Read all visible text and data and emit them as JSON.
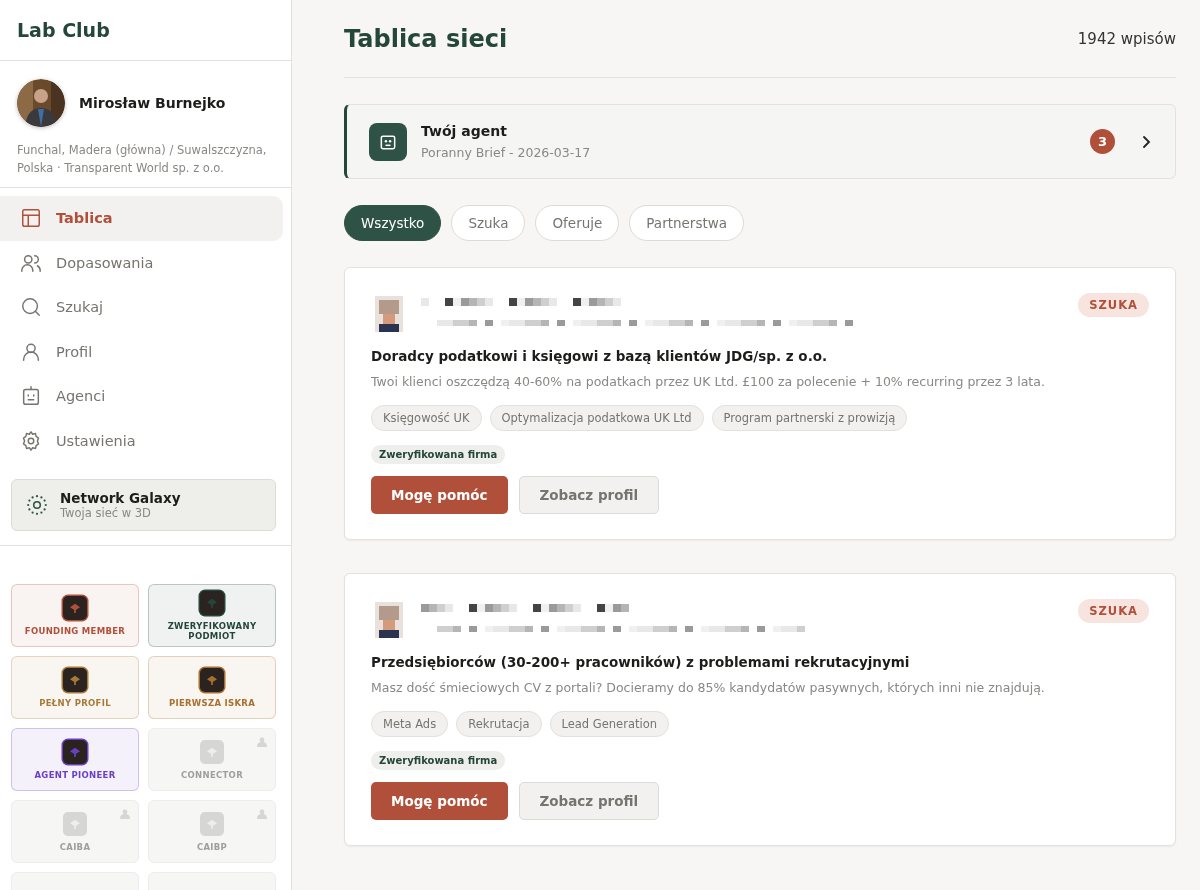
{
  "brand": "Lab Club",
  "profile": {
    "name": "Mirosław Burnejko",
    "details": "Funchal, Madera (główna) / Suwalszczyzna, Polska · Transparent World sp. z o.o."
  },
  "nav": [
    {
      "label": "Tablica",
      "selected": true
    },
    {
      "label": "Dopasowania",
      "selected": false
    },
    {
      "label": "Szukaj",
      "selected": false
    },
    {
      "label": "Profil",
      "selected": false
    },
    {
      "label": "Agenci",
      "selected": false
    },
    {
      "label": "Ustawienia",
      "selected": false
    }
  ],
  "galaxy": {
    "title": "Network Galaxy",
    "subtitle": "Twoja sieć w 3D"
  },
  "badges": [
    {
      "label": "FOUNDING MEMBER",
      "locked": false,
      "color": "#b0503a"
    },
    {
      "label": "ZWERYFIKOWANY PODMIOT",
      "locked": false,
      "color": "#24463b"
    },
    {
      "label": "PEŁNY PROFIL",
      "locked": false,
      "color": "#a77a3a"
    },
    {
      "label": "PIERWSZA ISKRA",
      "locked": false,
      "color": "#a96f2f"
    },
    {
      "label": "AGENT PIONEER",
      "locked": false,
      "color": "#6a3fc4"
    },
    {
      "label": "CONNECTOR",
      "locked": true
    },
    {
      "label": "CAIBA",
      "locked": true
    },
    {
      "label": "CAIBP",
      "locked": true
    },
    {
      "locked": true
    },
    {
      "locked": true
    }
  ],
  "header": {
    "title": "Tablica sieci",
    "count": "1942 wpisów"
  },
  "agent": {
    "title": "Twój agent",
    "subtitle": "Poranny Brief - 2026-03-17",
    "count": "3"
  },
  "filters": [
    {
      "label": "Wszystko",
      "selected": true
    },
    {
      "label": "Szuka",
      "selected": false
    },
    {
      "label": "Oferuje",
      "selected": false
    },
    {
      "label": "Partnerstwa",
      "selected": false
    }
  ],
  "posts": [
    {
      "type": "SZUKA",
      "title": "Doradcy podatkowi i księgowi z bazą klientów JDG/sp. z o.o.",
      "text": "Twoi klienci oszczędzą 40-60% na podatkach przez UK Ltd. £100 za polecenie + 10% recurring przez 3 lata.",
      "tags": [
        "Księgowość UK",
        "Optymalizacja podatkowa UK Ltd",
        "Program partnerski z prowizją"
      ],
      "verified": "Zweryfikowana firma",
      "buttons": [
        "Mogę pomóc",
        "Zobacz profil"
      ]
    },
    {
      "type": "SZUKA",
      "title": "Przedsiębiorców (30-200+ pracowników) z problemami rekrutacyjnymi",
      "text": "Masz dość śmieciowych CV z portali? Docieramy do 85% kandydatów pasywnych, których inni nie znajdują.",
      "tags": [
        "Meta Ads",
        "Rekrutacja",
        "Lead Generation"
      ],
      "verified": "Zweryfikowana firma",
      "buttons": [
        "Mogę pomóc",
        "Zobacz profil"
      ]
    }
  ]
}
